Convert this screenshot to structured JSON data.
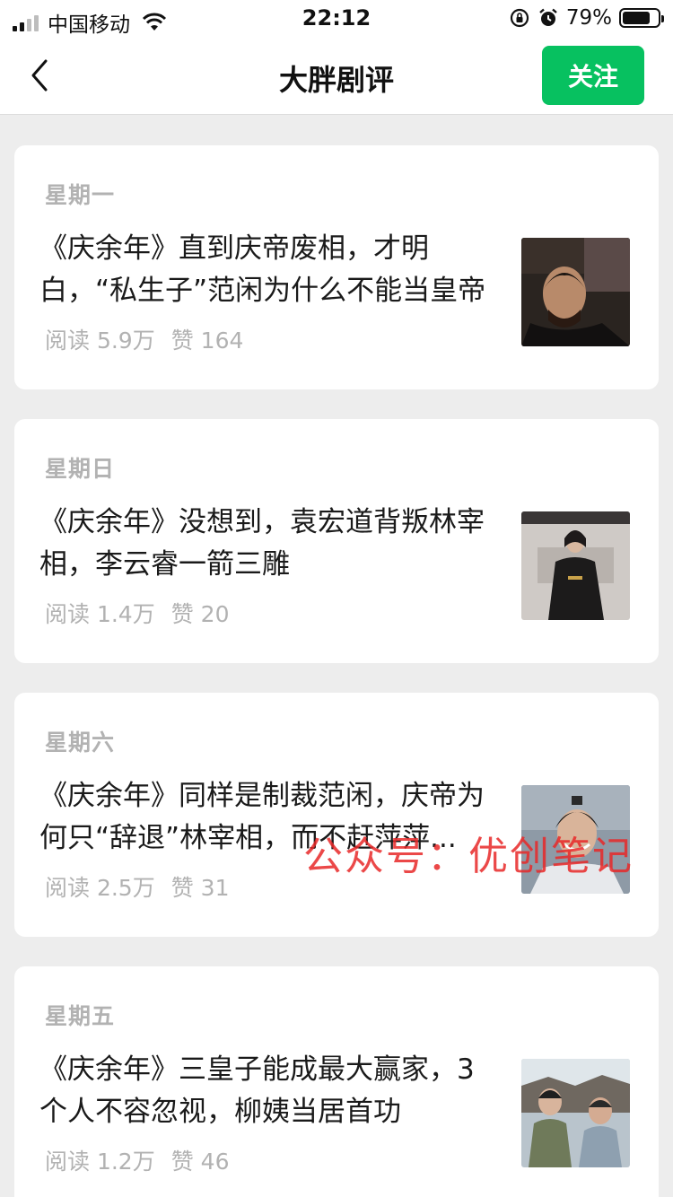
{
  "status_bar": {
    "carrier": "中国移动",
    "time": "22:12",
    "battery_percent": "79%",
    "battery_level": 0.79,
    "icons": [
      "signal-icon",
      "wifi-icon",
      "rotation-lock-icon",
      "alarm-icon",
      "battery-icon"
    ]
  },
  "nav": {
    "title": "大胖剧评",
    "follow_label": "关注",
    "back_icon": "chevron-left-icon"
  },
  "colors": {
    "accent": "#07c160",
    "background": "#ededed",
    "card": "#ffffff",
    "muted_text": "#b2b2b2",
    "watermark": "#e82828"
  },
  "articles": [
    {
      "day": "星期一",
      "title": "《庆余年》直到庆帝废相，才明白，“私生子”范闲为什么不能当皇帝",
      "reads": "阅读 5.9万",
      "likes": "赞 164"
    },
    {
      "day": "星期日",
      "title": "《庆余年》没想到，袁宏道背叛林宰相，李云睿一箭三雕",
      "reads": "阅读 1.4万",
      "likes": "赞 20"
    },
    {
      "day": "星期六",
      "title": "《庆余年》同样是制裁范闲，庆帝为何只“辞退”林宰相，而不赶萍萍...",
      "reads": "阅读 2.5万",
      "likes": "赞 31"
    },
    {
      "day": "星期五",
      "title": "《庆余年》三皇子能成最大赢家，3个人不容忽视，柳姨当居首功",
      "reads": "阅读 1.2万",
      "likes": "赞 46"
    }
  ],
  "watermark": "公众号：优创笔记"
}
